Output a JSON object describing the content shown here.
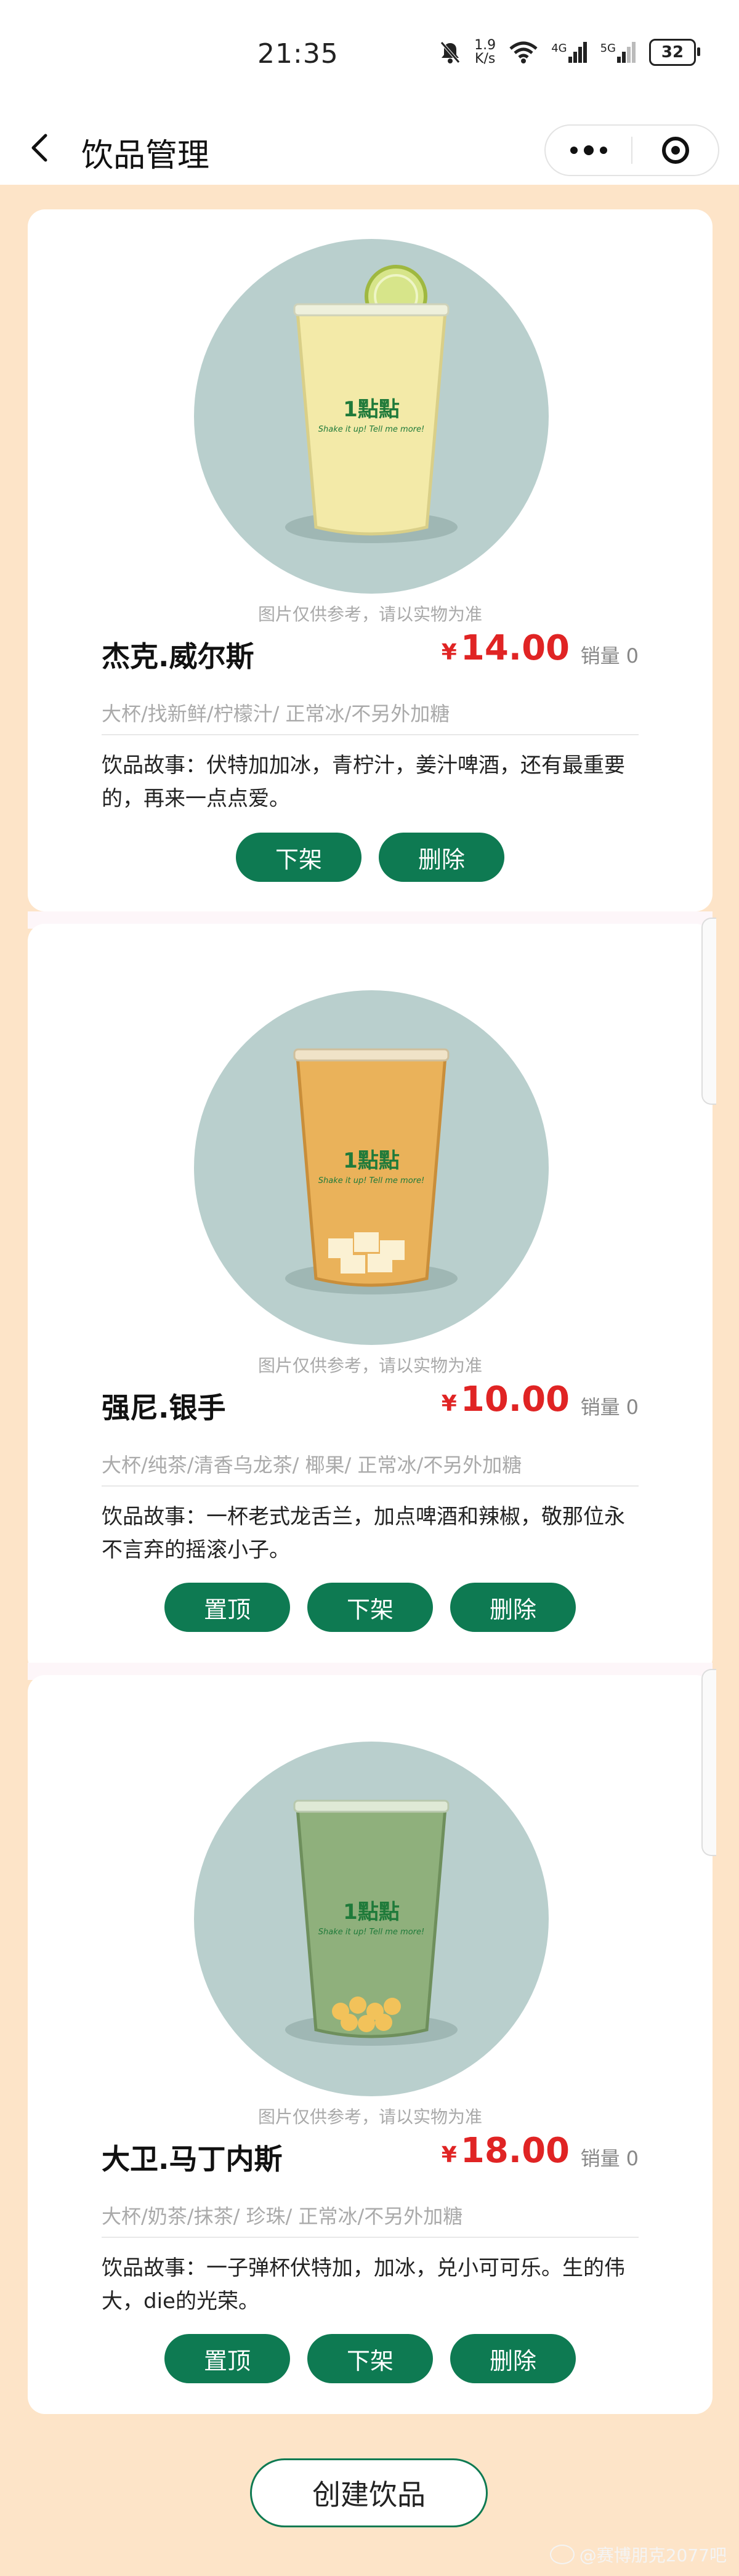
{
  "status_bar": {
    "time": "21:35",
    "net_speed_value": "1.9",
    "net_speed_unit": "K/s",
    "signal1_label": "4G",
    "signal2_label": "5G",
    "battery": "32"
  },
  "nav": {
    "title": "饮品管理"
  },
  "disclaimer": "图片仅供参考，请以实物为准",
  "sales_label": "销量",
  "currency": "¥",
  "cup_logo": "1點點",
  "cup_slogan": "Shake it up! Tell me more!",
  "drinks": [
    {
      "name": "杰克.威尔斯",
      "price": "14.00",
      "sales": "0",
      "tags": "大杯/找新鲜/柠檬汁/ 正常冰/不另外加糖",
      "story": "饮品故事：伏特加加冰，青柠汁，姜汁啤酒，还有最重要的，再来一点点爱。",
      "drink_color": "#f3eaa8",
      "buttons": [
        "下架",
        "删除"
      ]
    },
    {
      "name": "强尼.银手",
      "price": "10.00",
      "sales": "0",
      "tags": "大杯/纯茶/清香乌龙茶/ 椰果/ 正常冰/不另外加糖",
      "story": "饮品故事：一杯老式龙舌兰，加点啤酒和辣椒，敬那位永不言弃的摇滚小子。",
      "drink_color": "#eab25a",
      "buttons": [
        "置顶",
        "下架",
        "删除"
      ]
    },
    {
      "name": "大卫.马丁内斯",
      "price": "18.00",
      "sales": "0",
      "tags": "大杯/奶茶/抹茶/ 珍珠/ 正常冰/不另外加糖",
      "story": "饮品故事：一子弹杯伏特加，加冰，兑小可可乐。生的伟大，die的光荣。",
      "drink_color": "#8fb07c",
      "buttons": [
        "置顶",
        "下架",
        "删除"
      ]
    }
  ],
  "create_button": "创建饮品",
  "watermark": "@赛博朋克2077吧",
  "colors": {
    "accent": "#0e7a52",
    "price": "#e02424",
    "background": "#fde4c8",
    "image_circle": "#b9cfcd"
  }
}
